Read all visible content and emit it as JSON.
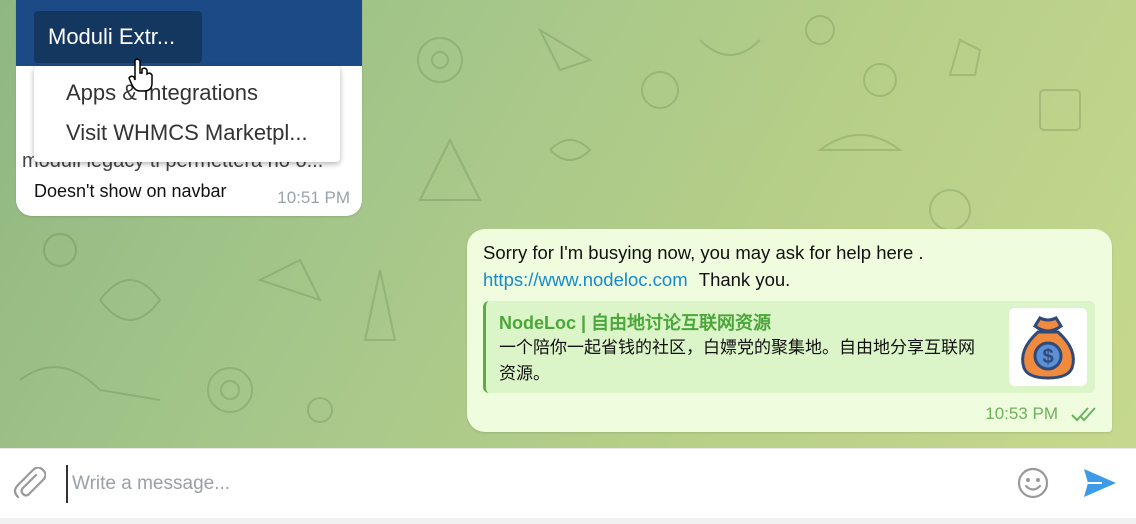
{
  "incoming": {
    "screenshot": {
      "nav_button": "Moduli Extr...",
      "menu_items": [
        "Apps & Integrations",
        "Visit WHMCS Marketpl..."
      ],
      "behind_text": "moduli legacy ti permettera no o..."
    },
    "text": "Doesn't show on navbar",
    "time": "10:51 PM"
  },
  "outgoing": {
    "line1": "Sorry for I'm busying now, you may ask for help here .",
    "link": "https://www.nodeloc.com",
    "after_link": "Thank you.",
    "preview": {
      "title": "NodeLoc | 自由地讨论互联网资源",
      "description": "一个陪你一起省钱的社区，白嫖党的聚集地。自由地分享互联网资源。",
      "thumb_icon": "money-bag-icon"
    },
    "time": "10:53 PM",
    "status_icon": "double-check-icon"
  },
  "composer": {
    "placeholder": "Write a message...",
    "attach_icon": "paperclip-icon",
    "emoji_icon": "smiley-icon",
    "send_icon": "send-icon"
  },
  "colors": {
    "outgoing_bubble": "#effdde",
    "link": "#168acd",
    "accent_green": "#4ca73a",
    "send_blue": "#3d9ae8"
  }
}
